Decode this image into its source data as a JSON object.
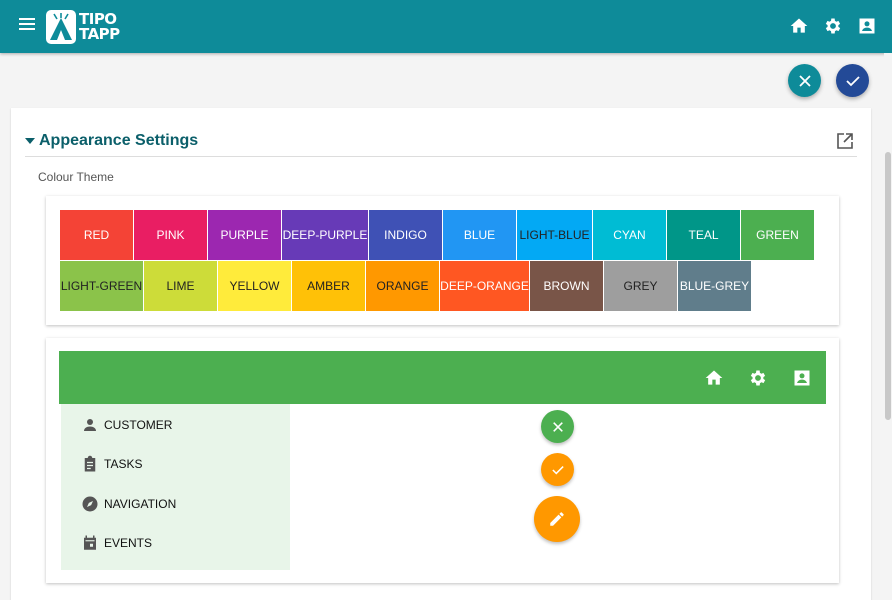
{
  "app": {
    "logo_line1": "TIPO",
    "logo_line2": "TAPP"
  },
  "colors": {
    "primary": "#0e8b99",
    "confirm": "#234a97",
    "preview_primary": "#4caf50",
    "preview_accent": "#ff9800",
    "preview_sidebar": "#e8f5e9"
  },
  "header": {
    "icons": [
      "menu-icon",
      "home-icon",
      "gear-icon",
      "contact-card-icon"
    ]
  },
  "section": {
    "title": "Appearance Settings",
    "field_label": "Colour Theme"
  },
  "themes": {
    "row1": [
      {
        "label": "RED",
        "color": "#f44336"
      },
      {
        "label": "PINK",
        "color": "#e91e63"
      },
      {
        "label": "PURPLE",
        "color": "#9c27b0"
      },
      {
        "label": "DEEP-PURPLE",
        "color": "#673ab7"
      },
      {
        "label": "INDIGO",
        "color": "#3f51b5"
      },
      {
        "label": "BLUE",
        "color": "#2196f3"
      },
      {
        "label": "LIGHT-BLUE",
        "color": "#03a9f4"
      },
      {
        "label": "CYAN",
        "color": "#00bcd4"
      },
      {
        "label": "TEAL",
        "color": "#009688"
      },
      {
        "label": "GREEN",
        "color": "#4caf50"
      }
    ],
    "row2": [
      {
        "label": "LIGHT-GREEN",
        "color": "#8bc34a"
      },
      {
        "label": "LIME",
        "color": "#cddc39"
      },
      {
        "label": "YELLOW",
        "color": "#ffeb3b"
      },
      {
        "label": "AMBER",
        "color": "#ffc107"
      },
      {
        "label": "ORANGE",
        "color": "#ff9800"
      },
      {
        "label": "DEEP-ORANGE",
        "color": "#ff5722"
      },
      {
        "label": "BROWN",
        "color": "#795548"
      },
      {
        "label": "GREY",
        "color": "#9e9e9e"
      },
      {
        "label": "BLUE-GREY",
        "color": "#607d8b"
      }
    ]
  },
  "preview": {
    "menu": [
      {
        "label": "CUSTOMER",
        "icon": "person-icon"
      },
      {
        "label": "TASKS",
        "icon": "clipboard-icon"
      },
      {
        "label": "NAVIGATION",
        "icon": "compass-icon"
      },
      {
        "label": "EVENTS",
        "icon": "calendar-icon"
      }
    ]
  }
}
